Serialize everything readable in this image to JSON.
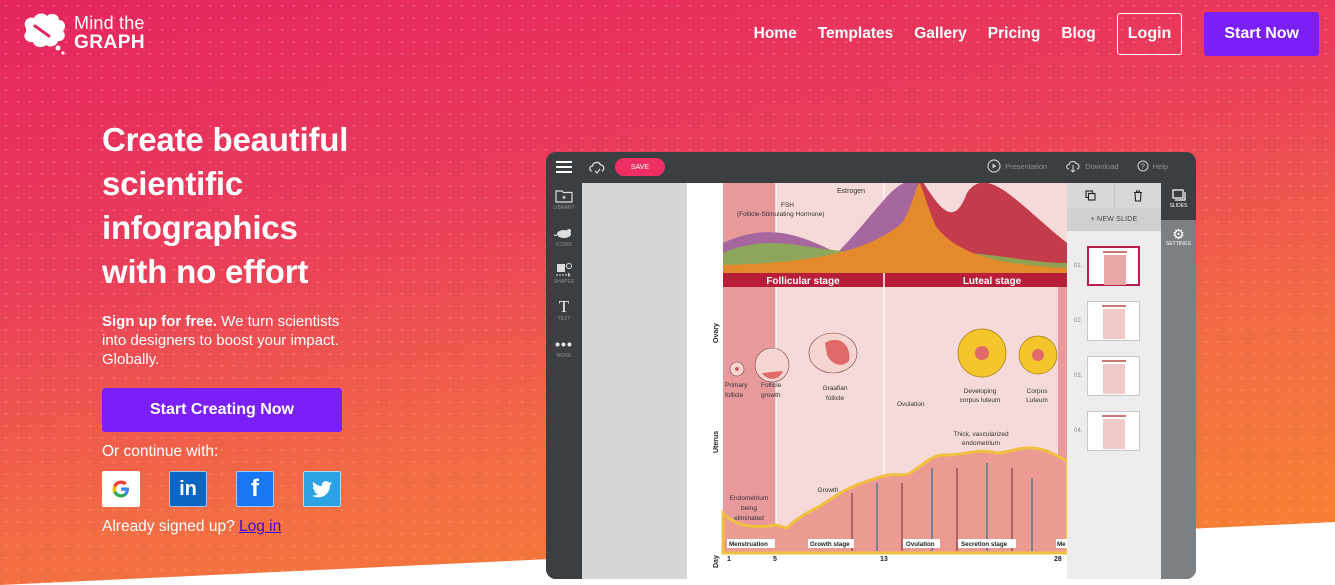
{
  "brand": {
    "line1": "Mind the",
    "line2": "GRAPH"
  },
  "nav": {
    "links": [
      "Home",
      "Templates",
      "Gallery",
      "Pricing",
      "Blog"
    ],
    "login": "Login",
    "start": "Start Now"
  },
  "hero": {
    "headline": [
      "Create beautiful",
      "scientific",
      "infographics",
      "with no effort"
    ],
    "sub_bold": "Sign up for free.",
    "sub_rest": " We turn scientists into designers to boost your impact. Globally.",
    "cta": "Start Creating Now",
    "continue": "Or continue with:",
    "socials": [
      "google-icon",
      "linkedin-icon",
      "facebook-icon",
      "twitter-icon"
    ],
    "already": "Already signed up? ",
    "login_link": "Log in"
  },
  "app": {
    "save": "SAVE",
    "toolbar": {
      "presentation": "Presentation",
      "download": "Download",
      "help": "Help"
    },
    "leftbar": [
      "LIBRARY",
      "ICONS",
      "SHAPES",
      "TEXT",
      "MORE"
    ],
    "new_slide": "+ NEW SLIDE",
    "slides": [
      "01.",
      "02.",
      "03.",
      "04."
    ],
    "vpanel": [
      "SLIDES",
      "SETTINGS"
    ],
    "infographic": {
      "hormones": [
        "FSH",
        "(Follicle-Stimulating Hormone)",
        "Estrogen"
      ],
      "stages": [
        "Follicular stage",
        "Luteal stage"
      ],
      "rows": [
        "Ovary",
        "Uterus",
        "Day"
      ],
      "ovary_labels": [
        "Primary follicle",
        "Follicle growth",
        "Graafian follicle",
        "Ovulation",
        "Developing corpus luteum",
        "Corpus Luteum"
      ],
      "uterus_labels": [
        "Endometrium being eliminated",
        "Growth",
        "Thick, vascularized endometrium"
      ],
      "phases": [
        "Menstruation",
        "Growth stage",
        "Ovulation",
        "Secretion stage",
        "Me"
      ],
      "days": [
        "1",
        "5",
        "13",
        "28"
      ]
    }
  },
  "colors": {
    "accent_purple": "#7b1ff9",
    "save_pink": "#ef2f64",
    "stage_red": "#b81e3a"
  }
}
